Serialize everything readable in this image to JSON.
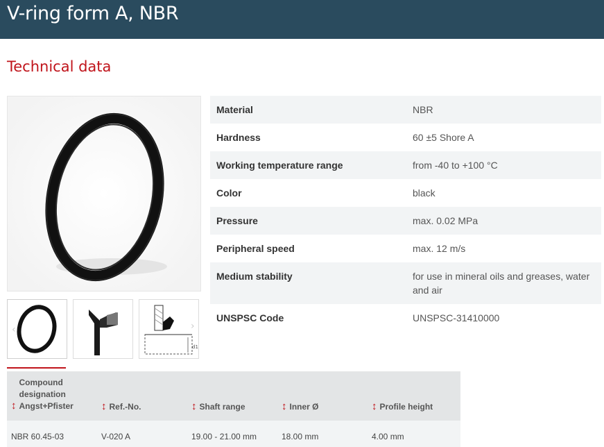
{
  "header": {
    "title": "V-ring form A, NBR"
  },
  "section": {
    "title": "Technical data"
  },
  "colors": {
    "header_bg": "#2a4b5e",
    "accent": "#c0141b",
    "row_alt": "#f2f4f5"
  },
  "gallery": {
    "main_image_icon": "v-ring-photo-icon",
    "thumbs": [
      {
        "icon": "v-ring-thumbnail-icon"
      },
      {
        "icon": "v-ring-profile-icon"
      },
      {
        "icon": "installation-drawing-icon"
      }
    ]
  },
  "specs": [
    {
      "label": "Material",
      "value": "NBR"
    },
    {
      "label": "Hardness",
      "value": "60 ±5 Shore A"
    },
    {
      "label": "Working temperature range",
      "value": "from -40 to +100 °C"
    },
    {
      "label": "Color",
      "value": "black"
    },
    {
      "label": "Pressure",
      "value": "max. 0.02 MPa"
    },
    {
      "label": "Peripheral speed",
      "value": "max. 12 m/s"
    },
    {
      "label": "Medium stability",
      "value": "for use in mineral oils and greases, water and air"
    },
    {
      "label": "UNSPSC Code",
      "value": "UNSPSC-31410000"
    }
  ],
  "compounds": {
    "sort_icon": "↕",
    "headers": {
      "compound_line1": "Compound",
      "compound_line2": "designation",
      "compound_line3": "Angst+Pfister",
      "ref_no": "Ref.-No.",
      "shaft_range": "Shaft range",
      "inner_d": "Inner Ø",
      "profile_height": "Profile height"
    },
    "rows": [
      {
        "compound": "NBR 60.45-03",
        "ref_no": "V-020 A",
        "shaft_range": "19.00 - 21.00 mm",
        "inner_d": "18.00 mm",
        "profile_height": "4.00 mm"
      }
    ]
  }
}
